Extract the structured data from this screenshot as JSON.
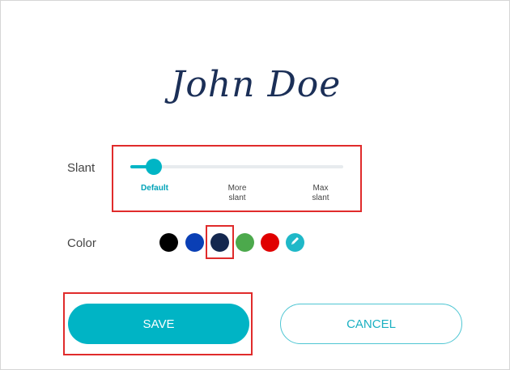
{
  "signature": {
    "text": "John Doe",
    "color": "#1b2f57"
  },
  "slant": {
    "label": "Slant",
    "selected_index": 0,
    "options": [
      {
        "line1": "Default",
        "line2": ""
      },
      {
        "line1": "More",
        "line2": "slant"
      },
      {
        "line1": "Max",
        "line2": "slant"
      }
    ],
    "accent_color": "#00b5c5"
  },
  "color": {
    "label": "Color",
    "selected": "navy",
    "swatches": [
      {
        "name": "black",
        "hex": "#000000"
      },
      {
        "name": "blue",
        "hex": "#0a3fb5"
      },
      {
        "name": "navy",
        "hex": "#14284f"
      },
      {
        "name": "green",
        "hex": "#4ca94c"
      },
      {
        "name": "red",
        "hex": "#e00000"
      },
      {
        "name": "custom-color-picker",
        "hex": "#1fb8c8",
        "icon": "pen-icon"
      }
    ]
  },
  "buttons": {
    "save_label": "SAVE",
    "cancel_label": "CANCEL",
    "primary_color": "#00b4c5"
  },
  "highlight_color": "#e02b2b"
}
